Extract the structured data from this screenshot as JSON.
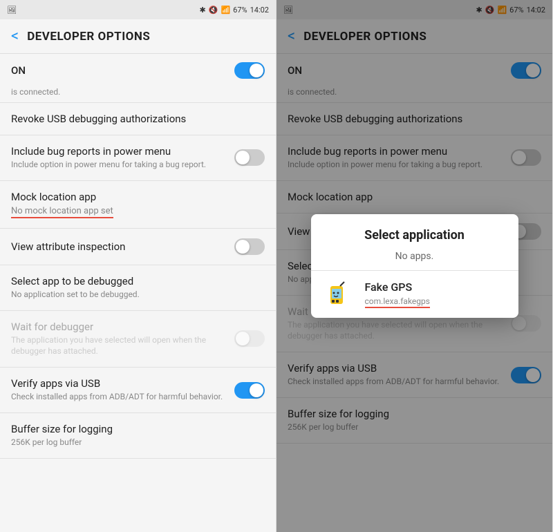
{
  "statusBar": {
    "leftIcon": "📷",
    "bluetooth": "bluetooth",
    "mute": "mute",
    "signal": "signal",
    "battery": "67%",
    "time": "14:02"
  },
  "panel1": {
    "backLabel": "<",
    "title": "DEVELOPER OPTIONS",
    "onLabel": "ON",
    "connectedText": "is connected.",
    "settings": [
      {
        "id": "revoke-usb",
        "title": "Revoke USB debugging authorizations",
        "subtitle": "",
        "hasToggle": false,
        "toggleOn": false,
        "disabled": false
      },
      {
        "id": "bug-reports",
        "title": "Include bug reports in power menu",
        "subtitle": "Include option in power menu for taking a bug report.",
        "hasToggle": true,
        "toggleOn": false,
        "disabled": false
      },
      {
        "id": "mock-location",
        "title": "Mock location app",
        "subtitle": "No mock location app set",
        "hasToggle": false,
        "toggleOn": false,
        "disabled": false,
        "isMockLocation": true
      },
      {
        "id": "view-attribute",
        "title": "View attribute inspection",
        "subtitle": "",
        "hasToggle": true,
        "toggleOn": false,
        "disabled": false
      },
      {
        "id": "select-debug-app",
        "title": "Select app to be debugged",
        "subtitle": "No application set to be debugged.",
        "hasToggle": false,
        "toggleOn": false,
        "disabled": false
      },
      {
        "id": "wait-debugger",
        "title": "Wait for debugger",
        "subtitle": "The application you have selected will open when the debugger has attached.",
        "hasToggle": true,
        "toggleOn": false,
        "disabled": true
      },
      {
        "id": "verify-usb",
        "title": "Verify apps via USB",
        "subtitle": "Check installed apps from ADB/ADT for harmful behavior.",
        "hasToggle": true,
        "toggleOn": true,
        "disabled": false
      },
      {
        "id": "buffer-size",
        "title": "Buffer size for logging",
        "subtitle": "256K per log buffer",
        "hasToggle": false,
        "toggleOn": false,
        "disabled": false
      }
    ]
  },
  "panel2": {
    "backLabel": "<",
    "title": "DEVELOPER OPTIONS",
    "onLabel": "ON",
    "connectedText": "is connected.",
    "dialog": {
      "title": "Select application",
      "noAppsText": "No apps.",
      "app": {
        "name": "Fake GPS",
        "package": "com.lexa.fakegps",
        "icon": "🎮"
      }
    },
    "settings": [
      {
        "id": "revoke-usb",
        "title": "Revoke USB debugging authorizations",
        "subtitle": "",
        "hasToggle": false,
        "toggleOn": false,
        "disabled": false
      },
      {
        "id": "bug-reports",
        "title": "Include bug reports in power menu",
        "subtitle": "Include option in power menu for taking a bug report.",
        "hasToggle": true,
        "toggleOn": false,
        "disabled": false
      },
      {
        "id": "mock-location",
        "title": "Mock location app",
        "subtitle": "",
        "hasToggle": false,
        "toggleOn": false,
        "disabled": false
      },
      {
        "id": "view-attribute",
        "title": "View attribute inspection",
        "subtitle": "",
        "hasToggle": true,
        "toggleOn": false,
        "disabled": false
      },
      {
        "id": "select-debug-app",
        "title": "Select app to be debugged",
        "subtitle": "No application set to be debugged.",
        "hasToggle": false,
        "toggleOn": false,
        "disabled": false
      },
      {
        "id": "wait-debugger",
        "title": "Wait for debugger",
        "subtitle": "The application you have selected will open when the debugger has attached.",
        "hasToggle": true,
        "toggleOn": false,
        "disabled": true
      },
      {
        "id": "verify-usb",
        "title": "Verify apps via USB",
        "subtitle": "Check installed apps from ADB/ADT for harmful behavior.",
        "hasToggle": true,
        "toggleOn": true,
        "disabled": false
      },
      {
        "id": "buffer-size",
        "title": "Buffer size for logging",
        "subtitle": "256K per log buffer",
        "hasToggle": false,
        "toggleOn": false,
        "disabled": false
      }
    ]
  }
}
